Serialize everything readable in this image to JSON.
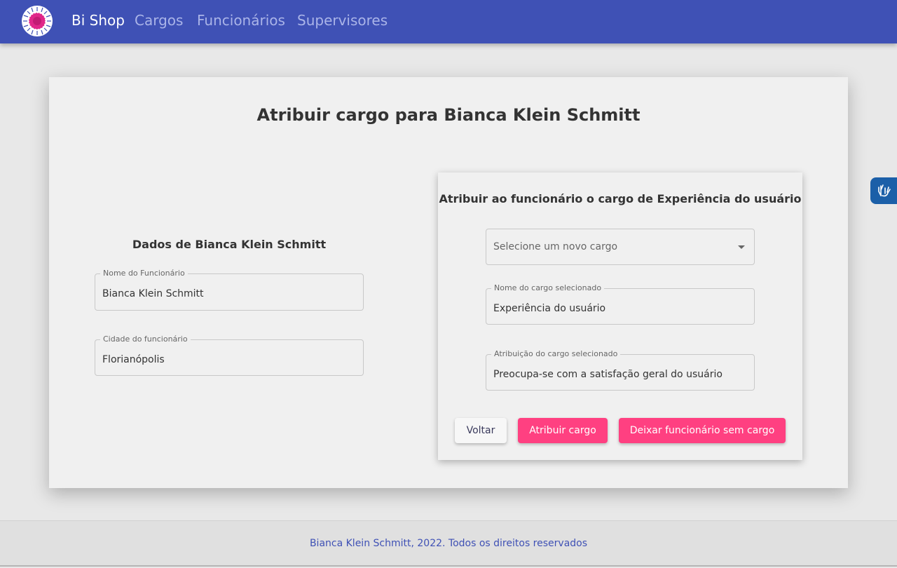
{
  "navbar": {
    "brand": "Bi Shop",
    "links": [
      "Cargos",
      "Funcionários",
      "Supervisores"
    ],
    "color": "#3f51b5"
  },
  "main": {
    "title": "Atribuir cargo para Bianca Klein Schmitt",
    "employee": {
      "heading": "Dados de Bianca Klein Schmitt",
      "name_label": "Nome do Funcionário",
      "name_value": "Bianca Klein Schmitt",
      "city_label": "Cidade do funcionário",
      "city_value": "Florianópolis"
    },
    "assign": {
      "heading": "Atribuir ao funcionário o cargo de Experiência do usuário",
      "select_placeholder": "Selecione um novo cargo",
      "cargo_label": "Nome do cargo selecionado",
      "cargo_value": "Experiência do usuário",
      "atrib_label": "Atribuição do cargo selecionado",
      "atrib_value": "Preocupa-se com a satisfação geral do usuário",
      "btn_voltar": "Voltar",
      "btn_atribuir": "Atribuir cargo",
      "btn_deixar": "Deixar funcionário sem cargo",
      "accent": "#ff4081"
    }
  },
  "footer": {
    "text": "Bianca Klein Schmitt, 2022. Todos os direitos reservados"
  },
  "icons": {
    "logo": "sun-wheel-logo-icon",
    "accessibility": "sign-language-hands-icon"
  }
}
